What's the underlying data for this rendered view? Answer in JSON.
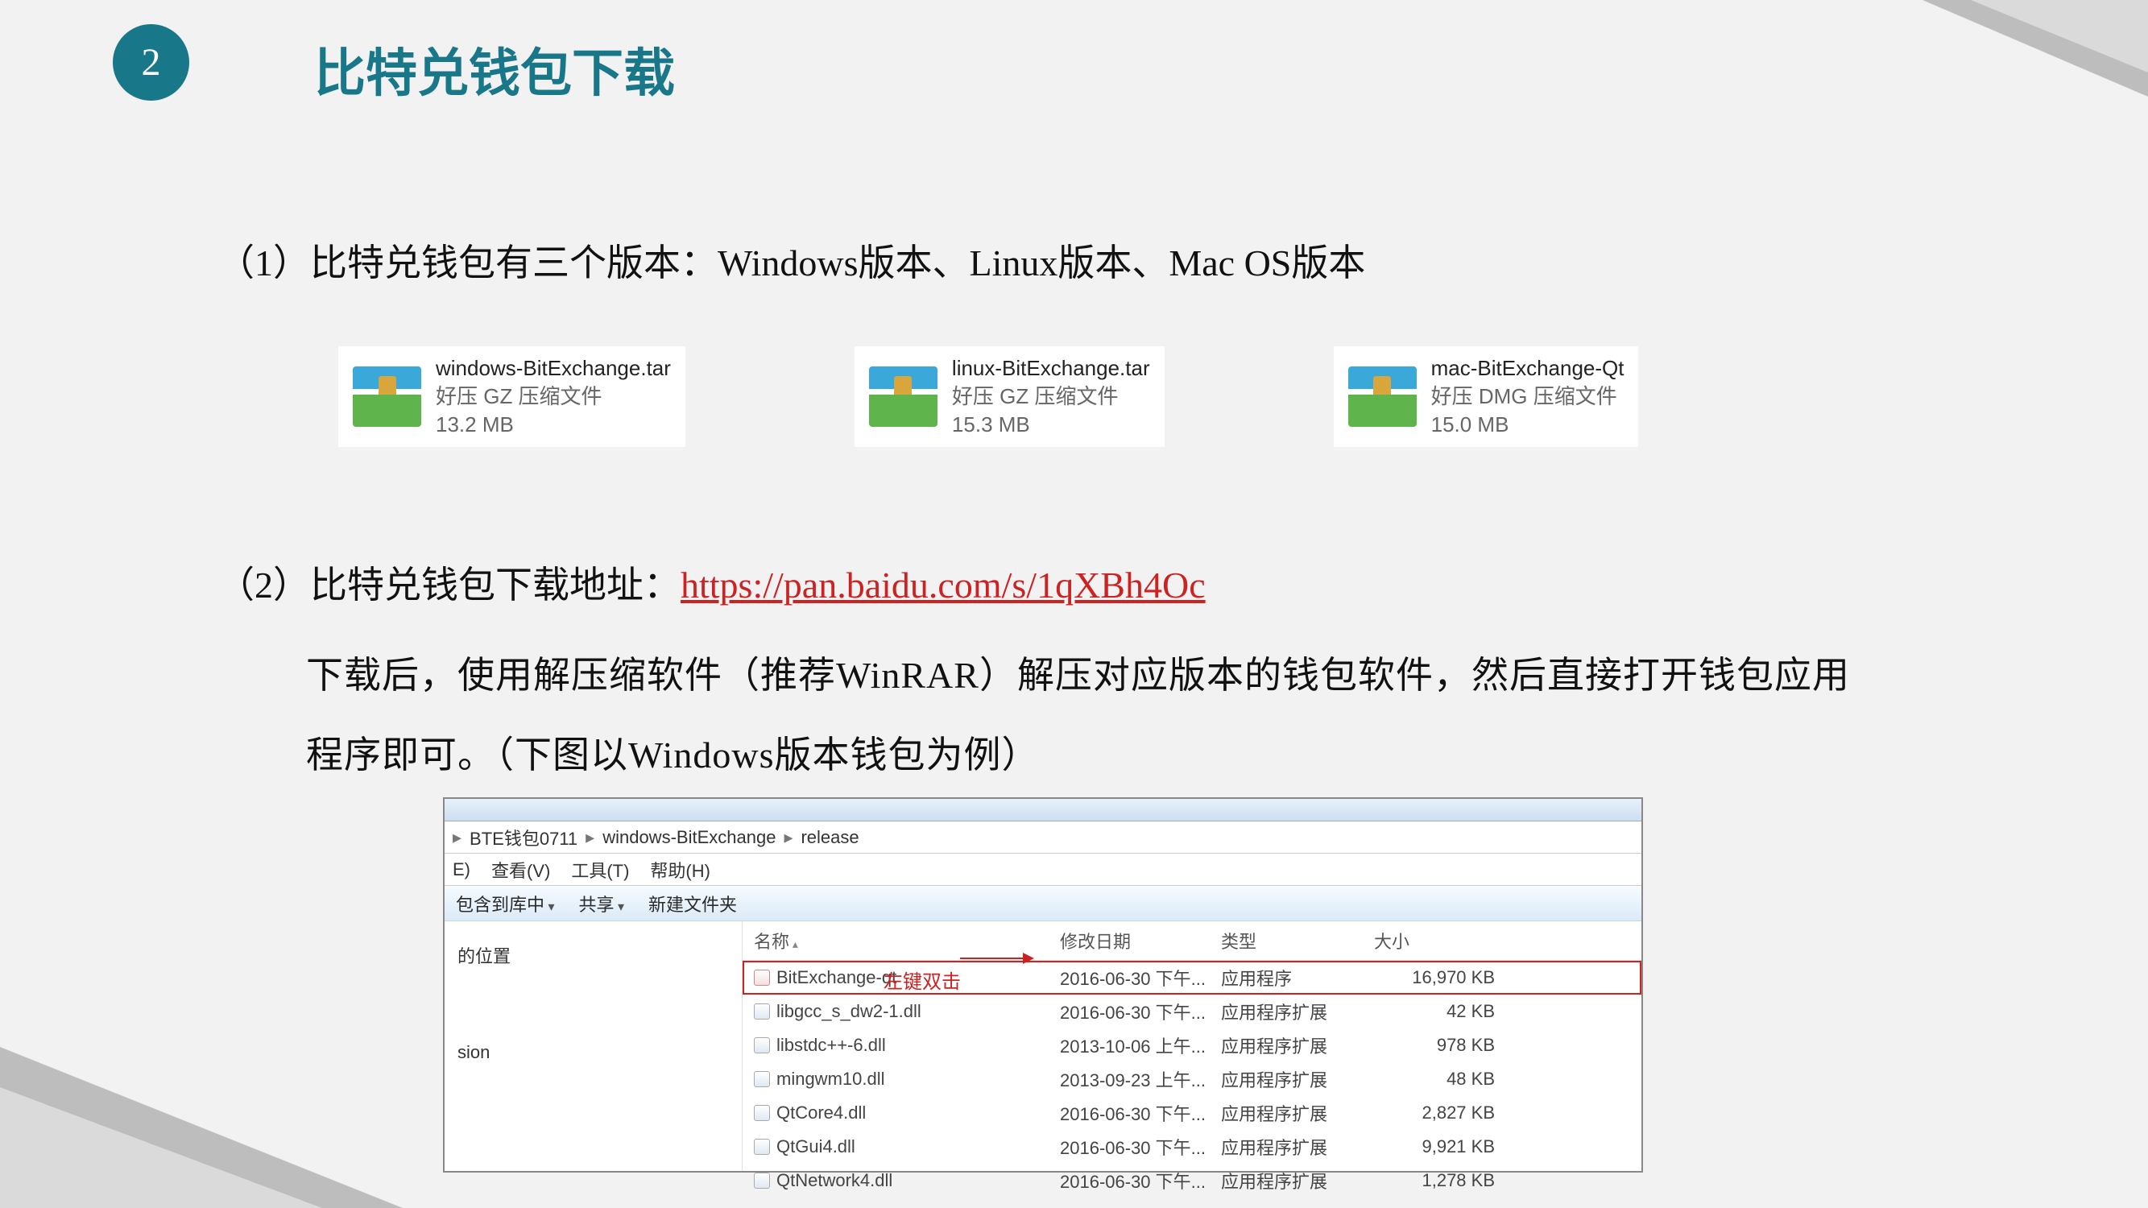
{
  "header": {
    "number": "2",
    "title": "比特兑钱包下载"
  },
  "line1": "（1）比特兑钱包有三个版本：Windows版本、Linux版本、Mac OS版本",
  "files": [
    {
      "name": "windows-BitExchange.tar",
      "type": "好压 GZ 压缩文件",
      "size": "13.2 MB"
    },
    {
      "name": "linux-BitExchange.tar",
      "type": "好压 GZ 压缩文件",
      "size": "15.3 MB"
    },
    {
      "name": "mac-BitExchange-Qt",
      "type": "好压 DMG 压缩文件",
      "size": "15.0 MB"
    }
  ],
  "line2_prefix": "（2）比特兑钱包下载地址：",
  "line2_link": "https://pan.baidu.com/s/1qXBh4Oc",
  "paragraph": "下载后，使用解压缩软件（推荐WinRAR）解压对应版本的钱包软件，然后直接打开钱包应用程序即可。（下图以Windows版本钱包为例）",
  "explorer": {
    "breadcrumb": [
      "BTE钱包0711",
      "windows-BitExchange",
      "release"
    ],
    "menu": {
      "e": "E)",
      "view": "查看(V)",
      "tools": "工具(T)",
      "help": "帮助(H)"
    },
    "toolbar": {
      "include": "包含到库中",
      "share": "共享",
      "newfolder": "新建文件夹"
    },
    "nav": {
      "pos": "的位置",
      "sion": "sion"
    },
    "columns": {
      "name": "名称",
      "date": "修改日期",
      "type": "类型",
      "size": "大小"
    },
    "rows": [
      {
        "name": "BitExchange-qt",
        "date": "2016-06-30 下午...",
        "type": "应用程序",
        "size": "16,970 KB",
        "exe": true,
        "hl": true
      },
      {
        "name": "libgcc_s_dw2-1.dll",
        "date": "2016-06-30 下午...",
        "type": "应用程序扩展",
        "size": "42 KB"
      },
      {
        "name": "libstdc++-6.dll",
        "date": "2013-10-06 上午...",
        "type": "应用程序扩展",
        "size": "978 KB"
      },
      {
        "name": "mingwm10.dll",
        "date": "2013-09-23 上午...",
        "type": "应用程序扩展",
        "size": "48 KB"
      },
      {
        "name": "QtCore4.dll",
        "date": "2016-06-30 下午...",
        "type": "应用程序扩展",
        "size": "2,827 KB"
      },
      {
        "name": "QtGui4.dll",
        "date": "2016-06-30 下午...",
        "type": "应用程序扩展",
        "size": "9,921 KB"
      },
      {
        "name": "QtNetwork4.dll",
        "date": "2016-06-30 下午...",
        "type": "应用程序扩展",
        "size": "1,278 KB"
      }
    ],
    "annotation": "左键双击"
  }
}
